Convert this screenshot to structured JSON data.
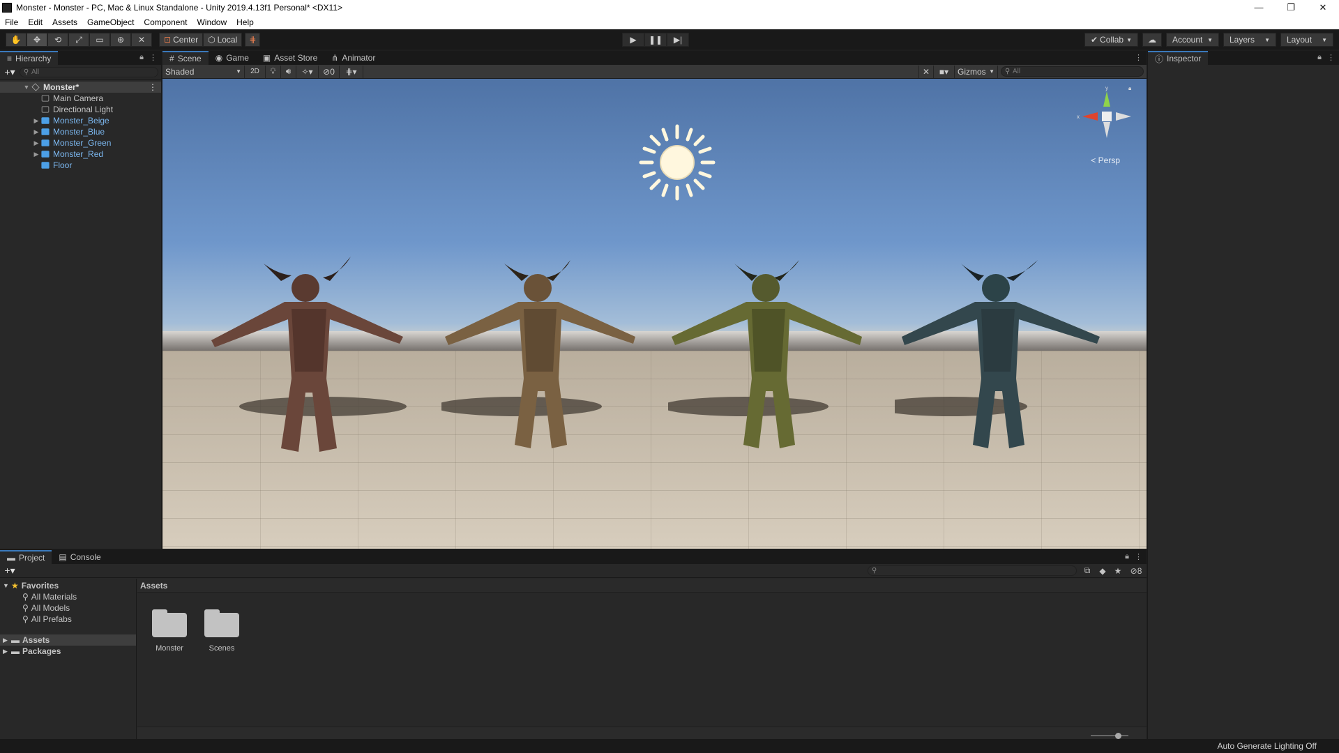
{
  "window": {
    "title": "Monster - Monster - PC, Mac & Linux Standalone - Unity 2019.4.13f1 Personal* <DX11>",
    "controls": [
      "—",
      "❐",
      "✕"
    ]
  },
  "menu": [
    "File",
    "Edit",
    "Assets",
    "GameObject",
    "Component",
    "Window",
    "Help"
  ],
  "toolbar": {
    "tools": [
      "hand-tool",
      "move-tool",
      "rotate-tool",
      "scale-tool",
      "rect-tool",
      "transform-tool",
      "custom-tool"
    ],
    "pivot_label": "Center",
    "space_label": "Local",
    "collab_label": "Collab",
    "account_label": "Account",
    "layers_label": "Layers",
    "layout_label": "Layout"
  },
  "hierarchy": {
    "tab": "Hierarchy",
    "search_placeholder": "All",
    "root": "Monster*",
    "items": [
      {
        "label": "Main Camera",
        "type": "gameobject",
        "expandable": false
      },
      {
        "label": "Directional Light",
        "type": "gameobject",
        "expandable": false
      },
      {
        "label": "Monster_Beige",
        "type": "prefab",
        "expandable": true
      },
      {
        "label": "Monster_Blue",
        "type": "prefab",
        "expandable": true
      },
      {
        "label": "Monster_Green",
        "type": "prefab",
        "expandable": true
      },
      {
        "label": "Monster_Red",
        "type": "prefab",
        "expandable": true
      },
      {
        "label": "Floor",
        "type": "prefab",
        "expandable": false
      }
    ]
  },
  "scene": {
    "tabs": [
      "Scene",
      "Game",
      "Asset Store",
      "Animator"
    ],
    "shading_mode": "Shaded",
    "mode_2d": "2D",
    "hidden_count": "0",
    "gizmos_label": "Gizmos",
    "search_placeholder": "All",
    "persp_label": "Persp",
    "axis_x": "x",
    "axis_y": "y"
  },
  "inspector": {
    "tab": "Inspector"
  },
  "project": {
    "tabs": [
      "Project",
      "Console"
    ],
    "favorites_label": "Favorites",
    "favorites": [
      "All Materials",
      "All Models",
      "All Prefabs"
    ],
    "folders": [
      "Assets",
      "Packages"
    ],
    "breadcrumb": "Assets",
    "assets": [
      "Monster",
      "Scenes"
    ],
    "hidden_packages_count": "8"
  },
  "status": {
    "right_text": "Auto Generate Lighting Off"
  },
  "colors": {
    "accent": "#3a79bb",
    "prefab_text": "#7cb8f0",
    "sky_top": "#4f73a6",
    "floor": "#d7cdbd"
  }
}
